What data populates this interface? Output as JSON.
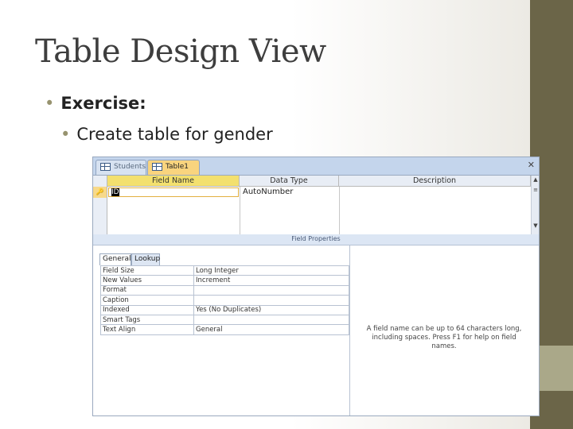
{
  "slide": {
    "title": "Table Design View",
    "bullet_1": "Exercise:",
    "bullet_2": "Create table for gender",
    "bullet_glyph": "•"
  },
  "colors": {
    "accent_bar": "#6b6548",
    "accent_light": "#aaa889",
    "active_tab": "#f9d47e"
  },
  "access": {
    "tabs": [
      {
        "label": "Students",
        "icon": "table-icon",
        "active": false
      },
      {
        "label": "Table1",
        "icon": "table-icon",
        "active": true
      }
    ],
    "close_glyph": "✕",
    "grid": {
      "headers": [
        "Field Name",
        "Data Type",
        "Description"
      ],
      "row": {
        "key_glyph": "🔑",
        "field_name": "ID",
        "data_type": "AutoNumber",
        "description": ""
      }
    },
    "scroll": {
      "up": "▲",
      "mid": "≡",
      "down": "▼"
    },
    "field_properties_label": "Field Properties",
    "property_tabs": [
      "General",
      "Lookup"
    ],
    "properties": [
      {
        "name": "Field Size",
        "value": "Long Integer"
      },
      {
        "name": "New Values",
        "value": "Increment"
      },
      {
        "name": "Format",
        "value": ""
      },
      {
        "name": "Caption",
        "value": ""
      },
      {
        "name": "Indexed",
        "value": "Yes (No Duplicates)"
      },
      {
        "name": "Smart Tags",
        "value": ""
      },
      {
        "name": "Text Align",
        "value": "General"
      }
    ],
    "help_text": "A field name can be up to 64 characters long, including spaces. Press F1 for help on field names."
  }
}
